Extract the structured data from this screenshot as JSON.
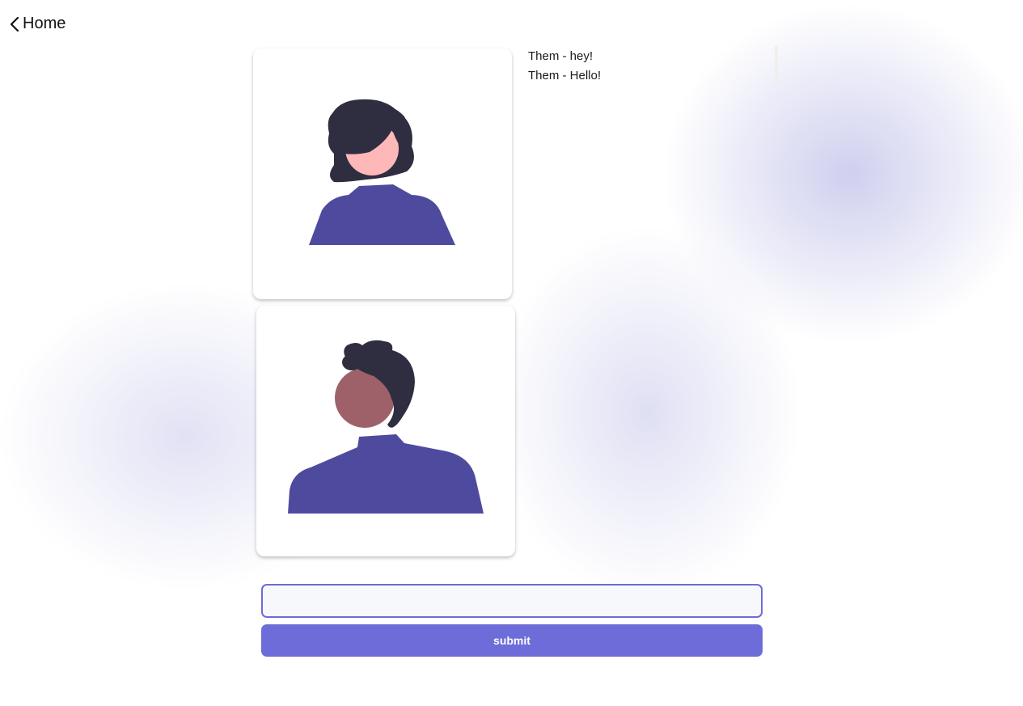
{
  "nav": {
    "back_label": "Home",
    "back_icon": "chevron-left-icon"
  },
  "video": {
    "remote_avatar": "woman-avatar",
    "local_avatar": "man-avatar"
  },
  "messages": [
    {
      "text": "Them - hey!"
    },
    {
      "text": "Them - Hello!"
    }
  ],
  "composer": {
    "input_value": "",
    "input_placeholder": "",
    "submit_label": "submit"
  },
  "colors": {
    "accent": "#6e6cd8",
    "shirt": "#4e4b9f",
    "hair": "#2f2e41",
    "skin_light": "#ffb8b8",
    "skin_dark": "#9e616a"
  }
}
